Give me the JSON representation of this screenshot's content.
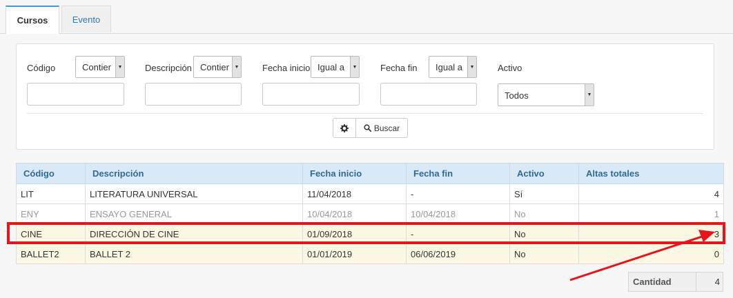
{
  "tabs": [
    {
      "label": "Cursos",
      "active": true
    },
    {
      "label": "Evento",
      "active": false
    }
  ],
  "filters": {
    "codigo": {
      "label": "Código",
      "operator": "Contier"
    },
    "descripcion": {
      "label": "Descripción",
      "operator": "Contier"
    },
    "fecha_inicio": {
      "label": "Fecha inicio",
      "operator": "Igual a"
    },
    "fecha_fin": {
      "label": "Fecha fin",
      "operator": "Igual a"
    },
    "activo": {
      "label": "Activo",
      "value": "Todos"
    }
  },
  "buttons": {
    "settings_icon": "gear-icon",
    "search_icon": "search-icon",
    "search_label": "Buscar"
  },
  "table": {
    "headers": [
      "Código",
      "Descripción",
      "Fecha inicio",
      "Fecha fin",
      "Activo",
      "Altas totales"
    ],
    "rows": [
      {
        "codigo": "LIT",
        "descripcion": "LITERATURA UNIVERSAL",
        "fecha_inicio": "11/04/2018",
        "fecha_fin": "-",
        "activo": "Sí",
        "altas": "4",
        "style": "white"
      },
      {
        "codigo": "ENY",
        "descripcion": "ENSAYO GENERAL",
        "fecha_inicio": "10/04/2018",
        "fecha_fin": "10/04/2018",
        "activo": "No",
        "altas": "1",
        "style": "grey"
      },
      {
        "codigo": "CINE",
        "descripcion": "DIRECCIÓN DE CINE",
        "fecha_inicio": "01/09/2018",
        "fecha_fin": "-",
        "activo": "No",
        "altas": "3",
        "style": "yellow"
      },
      {
        "codigo": "BALLET2",
        "descripcion": "BALLET 2",
        "fecha_inicio": "01/01/2019",
        "fecha_fin": "06/06/2019",
        "activo": "No",
        "altas": "0",
        "style": "yellow"
      }
    ]
  },
  "totals": {
    "label": "Cantidad",
    "value": "4"
  },
  "colors": {
    "accent": "#3a9ad9",
    "header_bg": "#d9e9f5",
    "highlight_row": "#fcf8e3",
    "annotation": "#e8141b"
  }
}
